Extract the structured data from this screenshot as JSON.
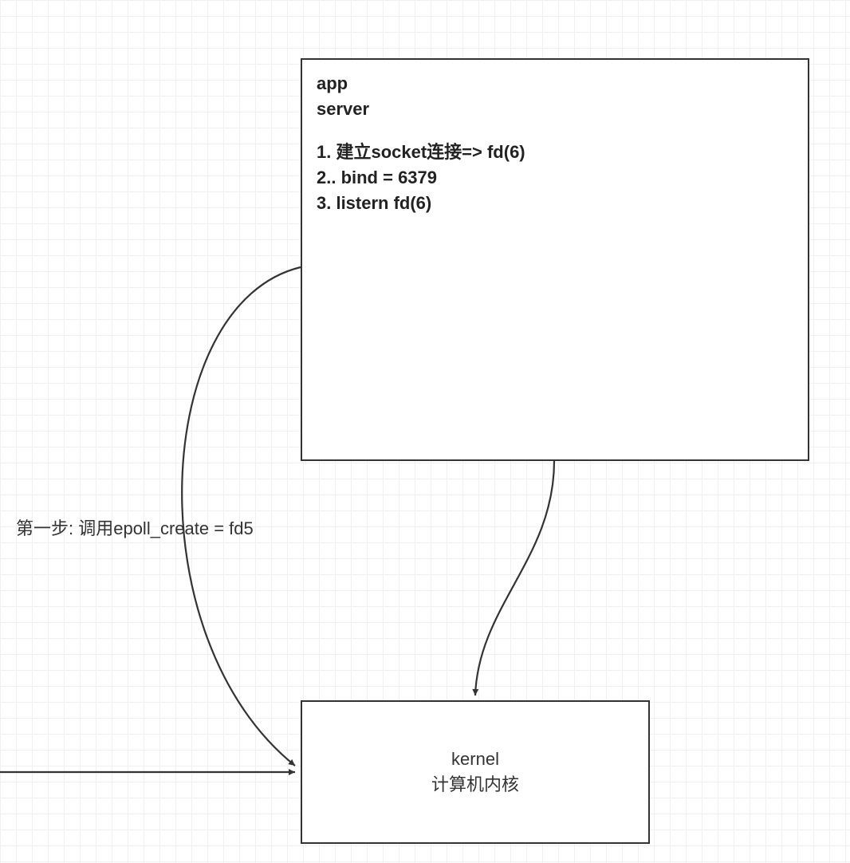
{
  "app_box": {
    "line1": "app",
    "line2": "server",
    "step1": "1. 建立socket连接=> fd(6)",
    "step2": "2.. bind = 6379",
    "step3": "3. listern fd(6)"
  },
  "kernel_box": {
    "line1": "kernel",
    "line2": "计算机内核"
  },
  "edge_label": "第一步: 调用epoll_create = fd5"
}
